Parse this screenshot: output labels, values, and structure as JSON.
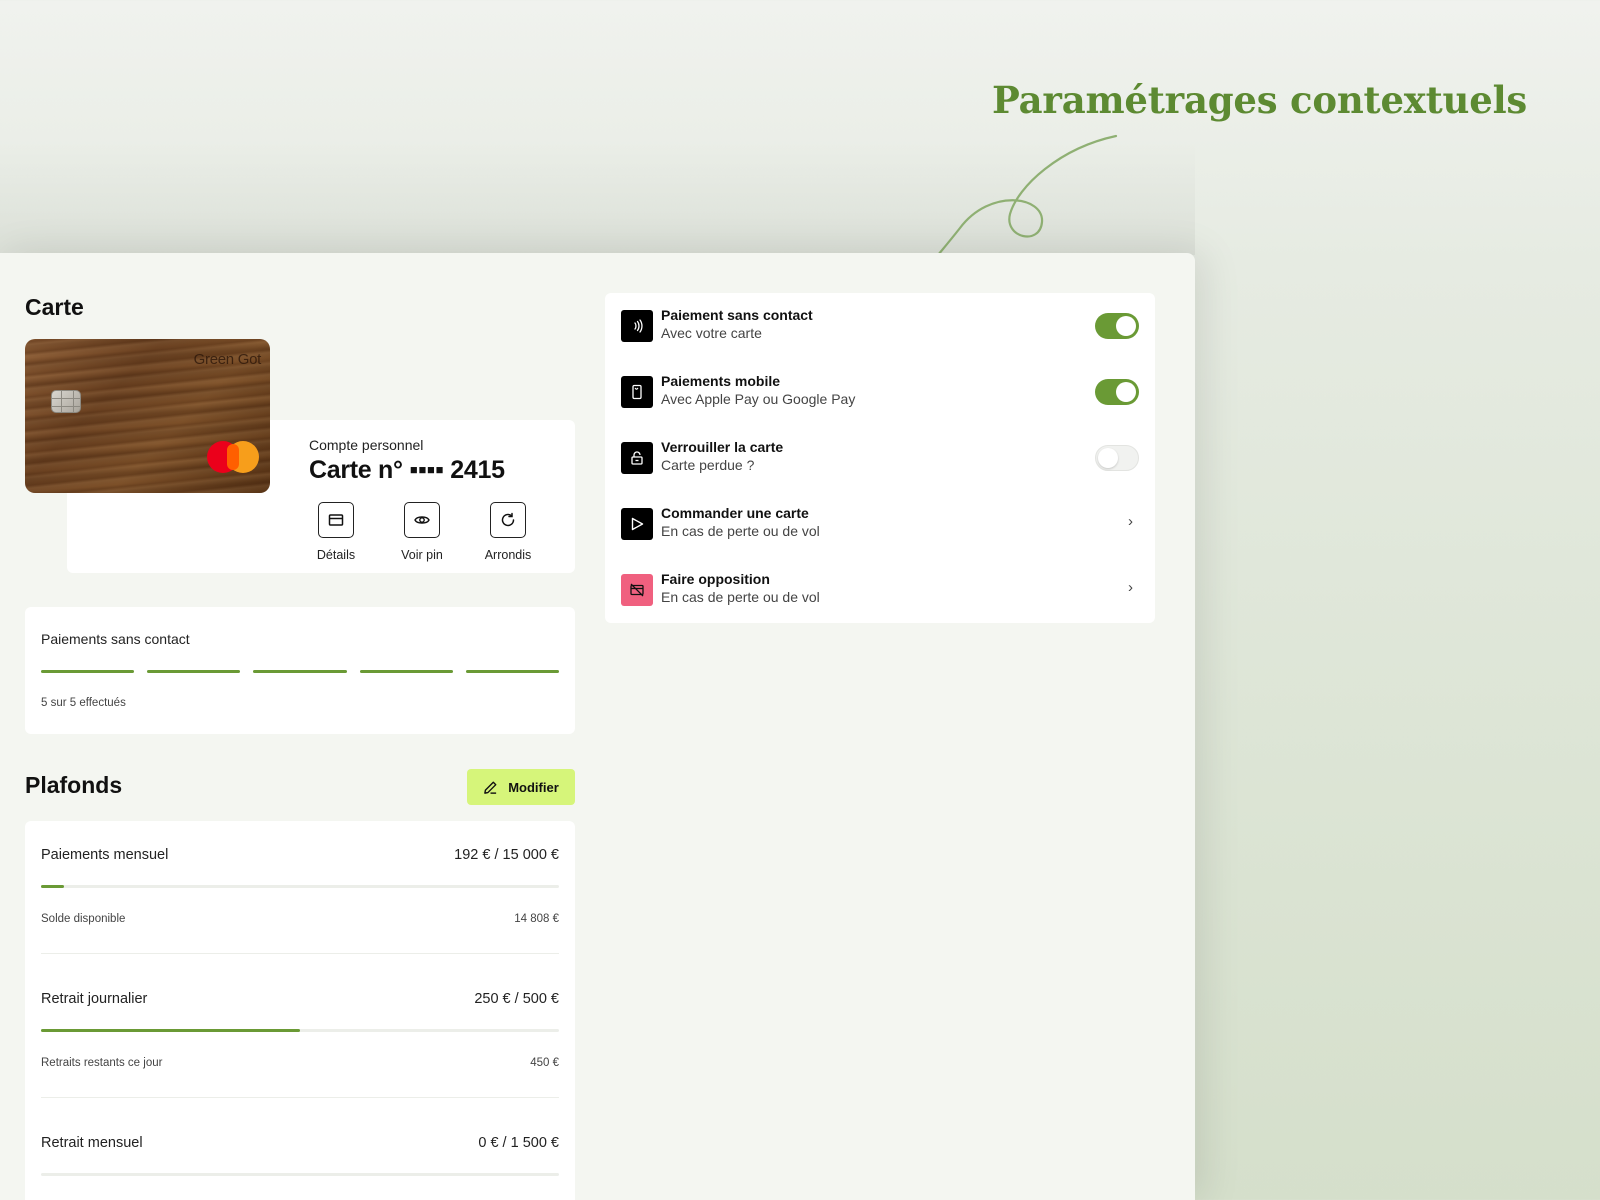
{
  "annotation": {
    "title": "Paramétrages contextuels"
  },
  "carte": {
    "title": "Carte",
    "brand": "Green Got",
    "account_label": "Compte personnel",
    "card_number": "Carte n° ▪▪▪▪ 2415",
    "actions": [
      {
        "label": "Détails",
        "icon": "card-icon"
      },
      {
        "label": "Voir pin",
        "icon": "eye-icon"
      },
      {
        "label": "Arrondis",
        "icon": "refresh-icon"
      }
    ]
  },
  "contactless_usage": {
    "label": "Paiements sans contact",
    "done": 5,
    "total": 5,
    "note": "5 sur 5 effectués"
  },
  "plafonds": {
    "title": "Plafonds",
    "edit_label": "Modifier",
    "items": [
      {
        "label": "Paiements mensuel",
        "value": "192 € / 15 000 €",
        "progress": 0.0128,
        "sub_label": "Solde disponible",
        "sub_value": "14 808 €"
      },
      {
        "label": "Retrait journalier",
        "value": "250 € / 500 €",
        "progress": 0.5,
        "sub_label": "Retraits restants ce jour",
        "sub_value": "450 €"
      },
      {
        "label": "Retrait mensuel",
        "value": "0 € / 1 500 €",
        "progress": 0
      }
    ]
  },
  "settings": [
    {
      "title": "Paiement sans contact",
      "subtitle": "Avec votre carte",
      "icon": "contactless-icon",
      "control": "toggle",
      "on": true
    },
    {
      "title": "Paiements mobile",
      "subtitle": "Avec Apple Pay ou Google Pay",
      "icon": "mobile-icon",
      "control": "toggle",
      "on": true
    },
    {
      "title": "Verrouiller la carte",
      "subtitle": "Carte perdue ?",
      "icon": "lock-icon",
      "control": "toggle",
      "on": false
    },
    {
      "title": "Commander une carte",
      "subtitle": "En cas de perte ou de vol",
      "icon": "send-icon",
      "control": "chevron"
    },
    {
      "title": "Faire opposition",
      "subtitle": "En cas de perte ou de vol",
      "icon": "card-off-icon",
      "control": "chevron",
      "accent": "#f0607f"
    }
  ],
  "colors": {
    "accent_green": "#6a9a35",
    "button_lime": "#d6f57a",
    "annotation_green": "#5d8a32",
    "danger_pink": "#f0607f"
  }
}
